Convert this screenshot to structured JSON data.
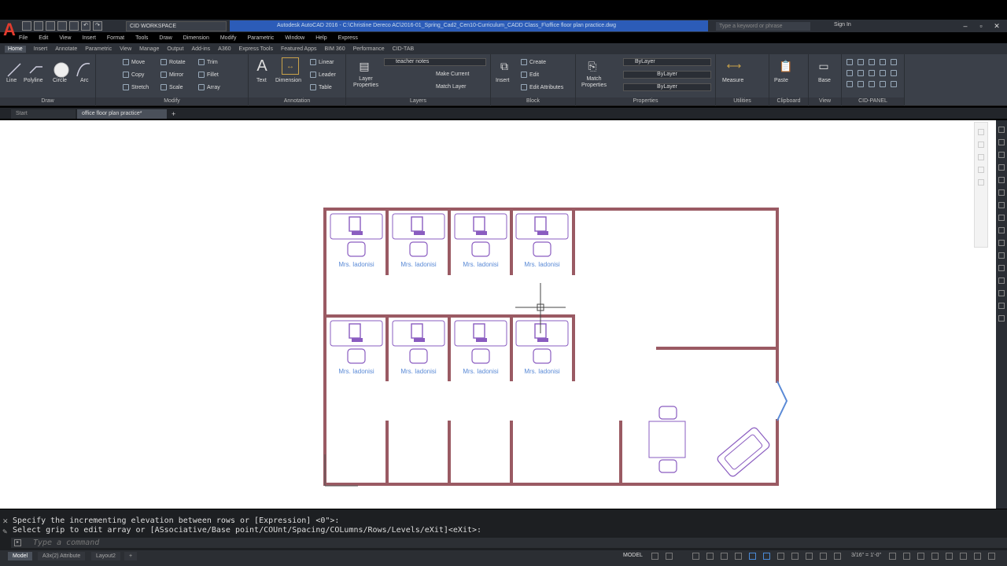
{
  "titlebar": {
    "workspace": "CID WORKSPACE",
    "document_title": "Autodesk AutoCAD 2016 - C:\\Christine Dereco AC\\2016-01_Spring_Cad2_Cen10-Curriculum_CADD Class_F\\office floor plan practice.dwg",
    "search_placeholder": "Type a keyword or phrase",
    "signin": "Sign In"
  },
  "menu": [
    "File",
    "Edit",
    "View",
    "Insert",
    "Format",
    "Tools",
    "Draw",
    "Dimension",
    "Modify",
    "Parametric",
    "Window",
    "Help",
    "Express"
  ],
  "ribbon_tabs": [
    "Home",
    "Insert",
    "Annotate",
    "Parametric",
    "View",
    "Manage",
    "Output",
    "Add-ins",
    "A360",
    "Express Tools",
    "Featured Apps",
    "BIM 360",
    "Performance",
    "CID-TAB"
  ],
  "ribbon": {
    "draw": {
      "title": "Draw",
      "line": "Line",
      "polyline": "Polyline",
      "circle": "Circle",
      "arc": "Arc"
    },
    "modify": {
      "title": "Modify",
      "move": "Move",
      "rotate": "Rotate",
      "trim": "Trim",
      "copy": "Copy",
      "mirror": "Mirror",
      "fillet": "Fillet",
      "stretch": "Stretch",
      "scale": "Scale",
      "array": "Array"
    },
    "annotation": {
      "title": "Annotation",
      "text": "Text",
      "dimension": "Dimension",
      "linear": "Linear",
      "leader": "Leader",
      "table": "Table"
    },
    "layers": {
      "title": "Layers",
      "layer_properties": "Layer Properties",
      "current_layer": "teacher notes",
      "make_current": "Make Current",
      "match_layer": "Match Layer"
    },
    "block": {
      "title": "Block",
      "insert": "Insert",
      "create": "Create",
      "edit": "Edit",
      "edit_attributes": "Edit Attributes"
    },
    "properties": {
      "title": "Properties",
      "match": "Match Properties",
      "color": "ByLayer",
      "linetype": "ByLayer",
      "lineweight": "ByLayer"
    },
    "utilities": {
      "title": "Utilities",
      "measure": "Measure"
    },
    "clipboard": {
      "title": "Clipboard",
      "paste": "Paste"
    },
    "view": {
      "title": "View",
      "base": "Base"
    },
    "cid": {
      "title": "CID-PANEL"
    }
  },
  "file_tabs": {
    "start": "Start",
    "active": "office floor plan practice*"
  },
  "drawing": {
    "desk_label": "Mrs. Iadonisi"
  },
  "command": {
    "line1": "Specify the incrementing elevation between rows or [Expression] <0\">:",
    "line2": "Select grip to edit array or [ASsociative/Base point/COUnt/Spacing/COLumns/Rows/Levels/eXit]<eXit>:",
    "placeholder": "Type a command"
  },
  "status": {
    "tabs": [
      "Model",
      "A3x(2) Attribute",
      "Layout2"
    ],
    "model": "MODEL",
    "scale": "3/16\" = 1'-0\""
  },
  "colors": {
    "wall": "#9a5a63",
    "furniture": "#8a5cc0",
    "label": "#5a8ad6",
    "door": "#5a8ad6",
    "doc_title_bg": "#2c5cb8"
  }
}
